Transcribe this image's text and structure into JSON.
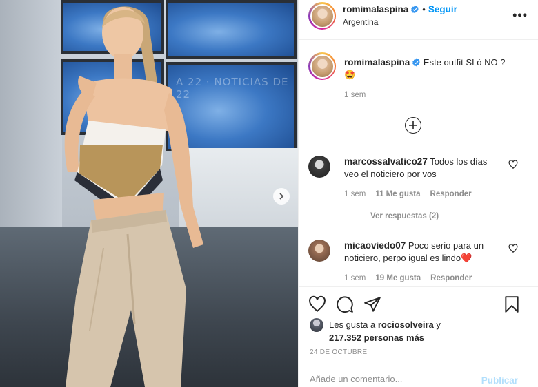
{
  "post": {
    "author": "romimalaspina",
    "follow_label": "Seguir",
    "dot": "•",
    "location": "Argentina",
    "more_label": "•••",
    "caption": "Este outfit SI ó NO ?",
    "caption_emoji": "🤩",
    "caption_time": "1 sem"
  },
  "comments": [
    {
      "username": "marcossalvatico27",
      "text": "Todos los días veo el noticiero por vos",
      "time": "1 sem",
      "likes": "11 Me gusta",
      "reply_label": "Responder",
      "view_replies": "Ver respuestas (2)"
    },
    {
      "username": "micaoviedo07",
      "text": "Poco serio para un noticiero, perpo igual es lindo",
      "emoji": "❤️",
      "time": "1 sem",
      "likes": "19 Me gusta",
      "reply_label": "Responder"
    }
  ],
  "likes_block": {
    "prefix": "Les gusta a",
    "first_user": "rociosolveira",
    "joiner": "y",
    "count_text": "217.352 personas más"
  },
  "date": "24 DE OCTUBRE",
  "comment_input": {
    "placeholder": "Añade un comentario...",
    "publish_label": "Publicar"
  },
  "colors": {
    "link_blue": "#0095f6",
    "publish_disabled": "#b2dffc",
    "muted": "#8e8e8e",
    "verified": "#3897f0",
    "heart_red": "#ed4956"
  },
  "icons": [
    "verified-badge-icon",
    "more-options-icon",
    "load-more-icon",
    "heart-icon",
    "comment-icon",
    "share-icon",
    "bookmark-icon",
    "next-arrow-icon"
  ]
}
